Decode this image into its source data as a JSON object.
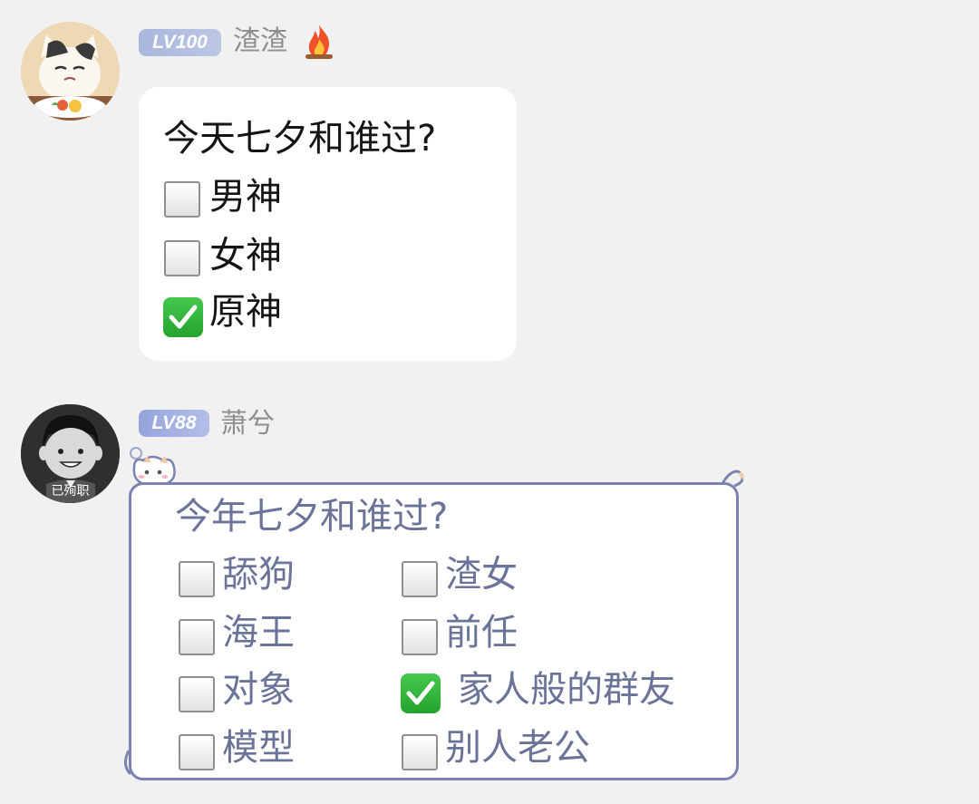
{
  "messages": [
    {
      "level": "LV100",
      "username": "渣渣",
      "title": "今天七夕和谁过?",
      "options": [
        {
          "label": "男神",
          "checked": false
        },
        {
          "label": "女神",
          "checked": false
        },
        {
          "label": "原神",
          "checked": true
        }
      ]
    },
    {
      "level": "LV88",
      "username": "萧兮",
      "avatar_caption": "已殉职",
      "title": "今年七夕和谁过?",
      "options": [
        {
          "label": "舔狗",
          "checked": false
        },
        {
          "label": "渣女",
          "checked": false
        },
        {
          "label": "海王",
          "checked": false
        },
        {
          "label": "前任",
          "checked": false
        },
        {
          "label": "对象",
          "checked": false
        },
        {
          "label": "家人般的群友",
          "checked": true
        },
        {
          "label": "模型",
          "checked": false
        },
        {
          "label": "别人老公",
          "checked": false
        }
      ]
    }
  ],
  "icons": {
    "flame": "fire-icon",
    "checkbox_empty": "checkbox-empty-icon",
    "checkbox_checked": "checkbox-checked-icon"
  },
  "colors": {
    "badge_lv100": "#a8b7dd",
    "badge_lv88": "#94a4dc",
    "check_green": "#2fb43a",
    "bubble2_border": "#7c83b0"
  }
}
